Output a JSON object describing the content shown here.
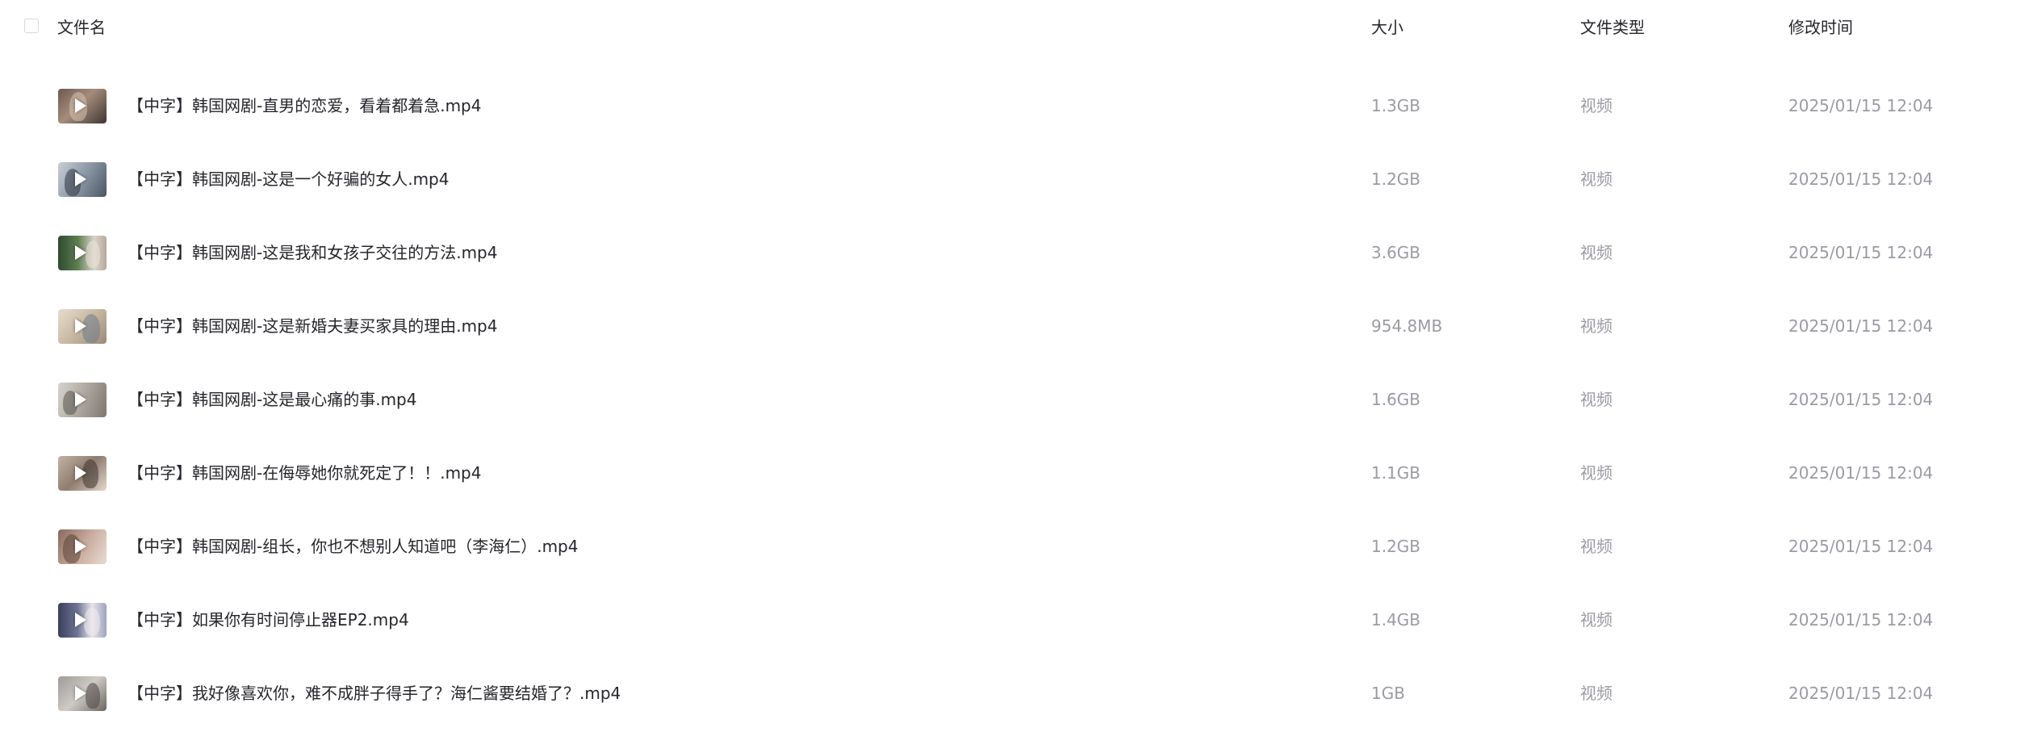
{
  "header": {
    "name": "文件名",
    "size": "大小",
    "type": "文件类型",
    "modified": "修改时间"
  },
  "files": [
    {
      "name": "【中字】韩国网剧-直男的恋爱，看着都着急.mp4",
      "size": "1.3GB",
      "type": "视频",
      "modified": "2025/01/15 12:04"
    },
    {
      "name": "【中字】韩国网剧-这是一个好骗的女人.mp4",
      "size": "1.2GB",
      "type": "视频",
      "modified": "2025/01/15 12:04"
    },
    {
      "name": "【中字】韩国网剧-这是我和女孩子交往的方法.mp4",
      "size": "3.6GB",
      "type": "视频",
      "modified": "2025/01/15 12:04"
    },
    {
      "name": "【中字】韩国网剧-这是新婚夫妻买家具的理由.mp4",
      "size": "954.8MB",
      "type": "视频",
      "modified": "2025/01/15 12:04"
    },
    {
      "name": "【中字】韩国网剧-这是最心痛的事.mp4",
      "size": "1.6GB",
      "type": "视频",
      "modified": "2025/01/15 12:04"
    },
    {
      "name": "【中字】韩国网剧-在侮辱她你就死定了！！.mp4",
      "size": "1.1GB",
      "type": "视频",
      "modified": "2025/01/15 12:04"
    },
    {
      "name": "【中字】韩国网剧-组长，你也不想别人知道吧（李海仁）.mp4",
      "size": "1.2GB",
      "type": "视频",
      "modified": "2025/01/15 12:04"
    },
    {
      "name": "【中字】如果你有时间停止器EP2.mp4",
      "size": "1.4GB",
      "type": "视频",
      "modified": "2025/01/15 12:04"
    },
    {
      "name": "【中字】我好像喜欢你，难不成胖子得手了？海仁酱要结婚了？.mp4",
      "size": "1GB",
      "type": "视频",
      "modified": "2025/01/15 12:04"
    }
  ],
  "thumb_icon": "play-icon",
  "colors": {
    "text_primary": "#25262b",
    "text_secondary": "#9a9ba3",
    "checkbox_border": "#d7d9de"
  }
}
